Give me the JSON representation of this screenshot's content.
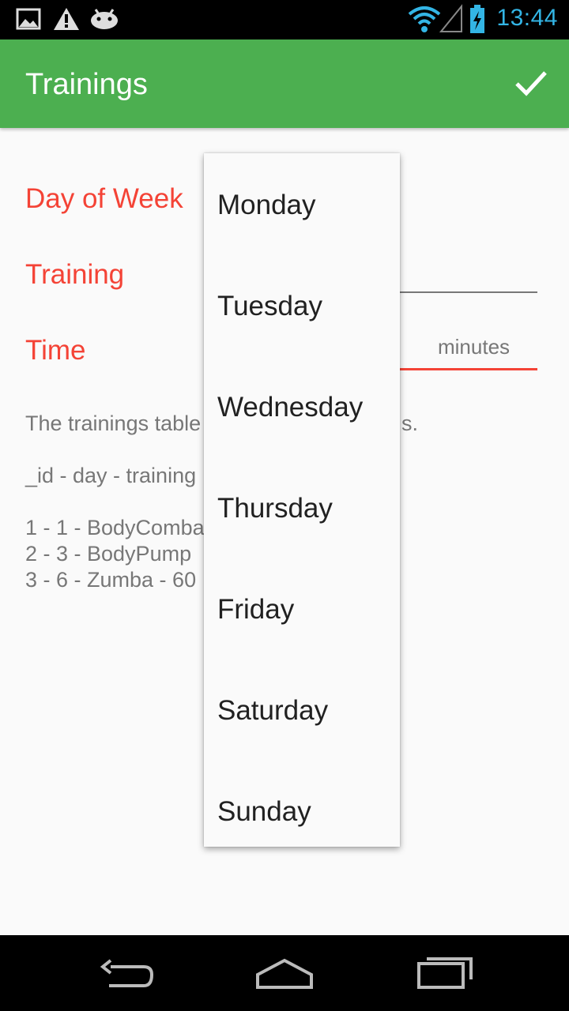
{
  "status_bar": {
    "time": "13:44",
    "icons": [
      "image-icon",
      "warning-icon",
      "android-icon",
      "wifi-icon",
      "signal-icon",
      "battery-charging-icon"
    ],
    "accent_color": "#33b5e5"
  },
  "app_bar": {
    "title": "Trainings",
    "confirm_icon": "check-icon",
    "color": "#4caf50"
  },
  "form": {
    "day_label": "Day of Week",
    "training_label": "Training",
    "time_label": "Time",
    "time_unit": "minutes",
    "label_color": "#f44336"
  },
  "description": {
    "line1": "The trainings table",
    "line1_tail": "s.",
    "header": "_id - day - training",
    "rows": [
      "1 - 1 - BodyComba",
      "2 - 3 - BodyPump",
      "3 - 6 - Zumba - 60"
    ]
  },
  "dropdown": {
    "options": [
      "Monday",
      "Tuesday",
      "Wednesday",
      "Thursday",
      "Friday",
      "Saturday",
      "Sunday"
    ]
  },
  "nav_bar": {
    "icons": [
      "back-icon",
      "home-icon",
      "recents-icon"
    ]
  }
}
